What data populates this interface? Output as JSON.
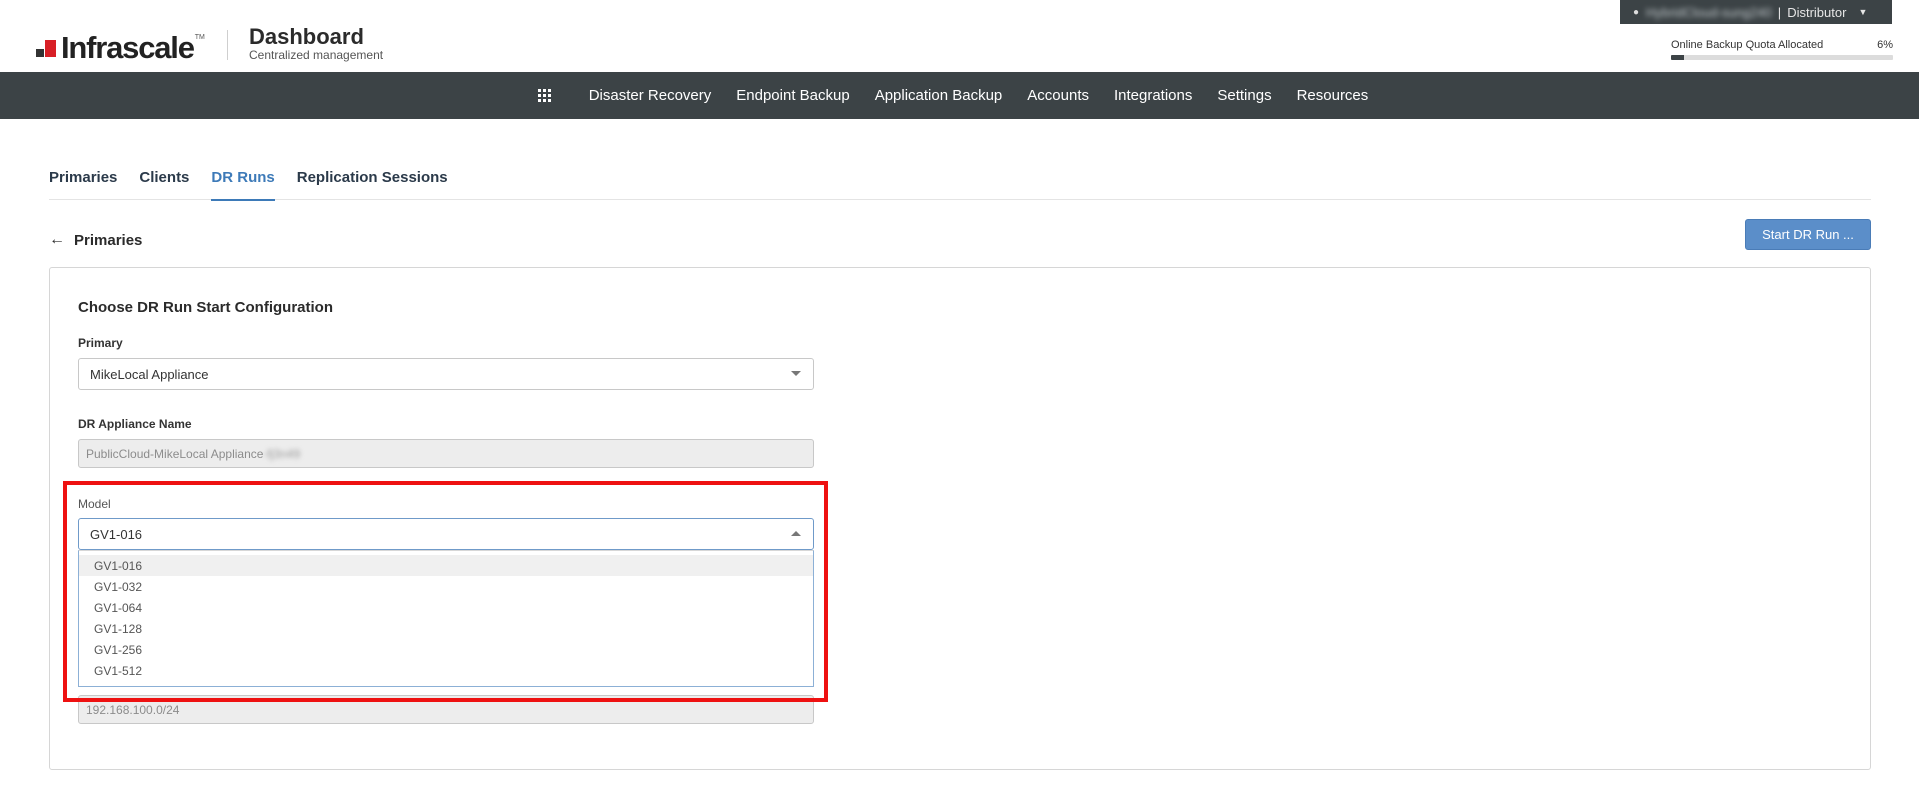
{
  "header": {
    "logo_text": "Infrascale",
    "logo_tm": "TM",
    "app_title": "Dashboard",
    "app_subtitle": "Centralized management",
    "user": {
      "name": "HybridCloud-sung240",
      "role": "Distributor",
      "separator": "|"
    },
    "quota": {
      "label": "Online Backup Quota Allocated",
      "percent_label": "6%",
      "percent": 6
    }
  },
  "nav": {
    "items": [
      "Disaster Recovery",
      "Endpoint Backup",
      "Application Backup",
      "Accounts",
      "Integrations",
      "Settings",
      "Resources"
    ]
  },
  "tabs": {
    "items": [
      {
        "label": "Primaries",
        "active": false
      },
      {
        "label": "Clients",
        "active": false
      },
      {
        "label": "DR Runs",
        "active": true
      },
      {
        "label": "Replication Sessions",
        "active": false
      }
    ]
  },
  "back_link": {
    "label": "Primaries"
  },
  "start_button": {
    "label": "Start DR Run ..."
  },
  "form": {
    "title": "Choose DR Run Start Configuration",
    "primary": {
      "label": "Primary",
      "value": "MikeLocal Appliance"
    },
    "dr_appliance_name": {
      "label": "DR Appliance Name",
      "value": "PublicCloud-MikeLocal Appliance",
      "hidden_suffix": "-fj3n49"
    },
    "model": {
      "label": "Model",
      "value": "GV1-016",
      "options": [
        "GV1-016",
        "GV1-032",
        "GV1-064",
        "GV1-128",
        "GV1-256",
        "GV1-512"
      ],
      "highlighted_index": 0
    },
    "network": {
      "value": "192.168.100.0/24"
    }
  },
  "colors": {
    "navbar_bg": "#3c4346",
    "accent_blue": "#3d7ab8",
    "button_blue": "#5b8ec9",
    "highlight_red": "#ee1111",
    "logo_red": "#d81f26"
  }
}
